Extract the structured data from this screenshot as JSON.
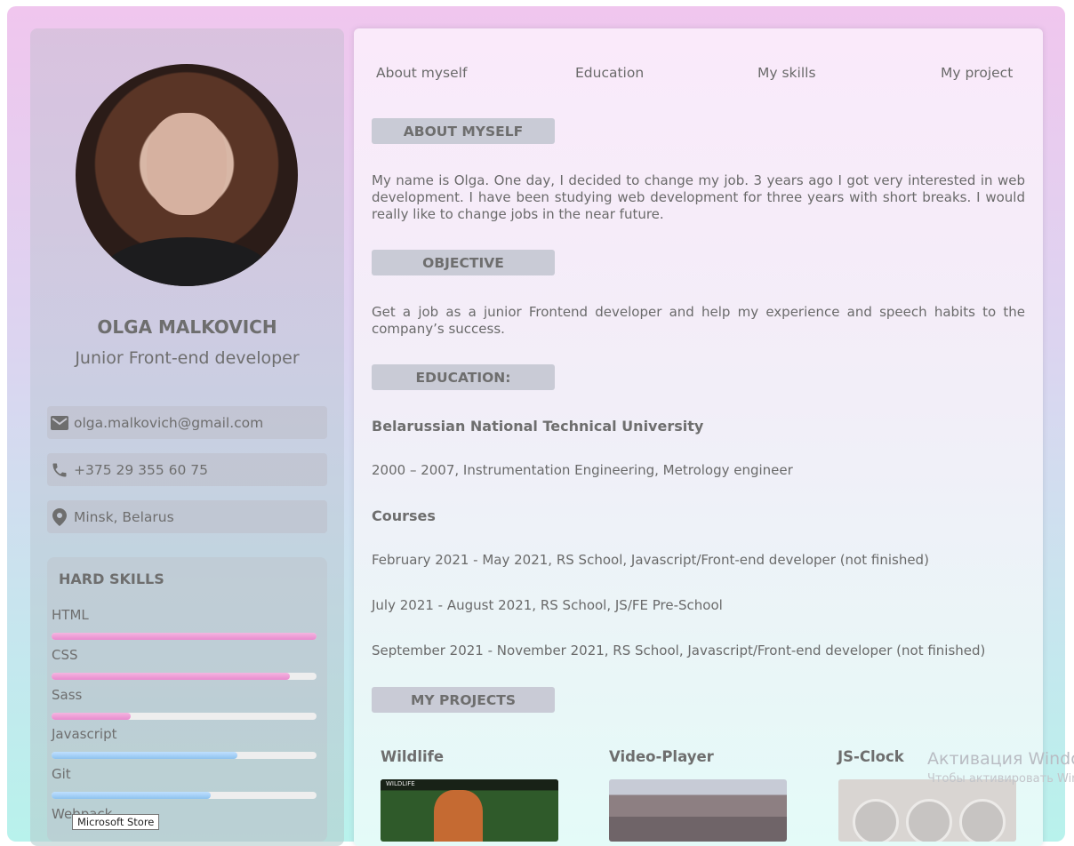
{
  "sidebar": {
    "name": "OLGA MALKOVICH",
    "role": "Junior Front-end developer",
    "contacts": [
      {
        "icon": "mail-icon",
        "text": "olga.malkovich@gmail.com"
      },
      {
        "icon": "phone-icon",
        "text": "+375 29 355 60 75"
      },
      {
        "icon": "location-pin-icon",
        "text": "Minsk, Belarus"
      }
    ],
    "hard_skills": {
      "title": "HARD SKILLS",
      "items": [
        {
          "label": "HTML",
          "level": 1.0,
          "color": "pink"
        },
        {
          "label": "CSS",
          "level": 0.9,
          "color": "pink"
        },
        {
          "label": "Sass",
          "level": 0.3,
          "color": "pink"
        },
        {
          "label": "Javascript",
          "level": 0.7,
          "color": "blue"
        },
        {
          "label": "Git",
          "level": 0.6,
          "color": "blue"
        },
        {
          "label": "Webpack",
          "level": 0.0,
          "color": "blue"
        }
      ]
    }
  },
  "nav": [
    "About myself",
    "Education",
    "My skills",
    "My project"
  ],
  "sections": {
    "about_heading": "ABOUT MYSELF",
    "about_text": "My name is Olga. One day, I decided to change my job. 3 years ago I got very interested in web development. I have been studying web development for three years with short breaks. I would really like to change jobs in the near future.",
    "objective_heading": "OBJECTIVE",
    "objective_text": "Get a job as a junior Frontend developer and help my experience and speech habits to the company’s success.",
    "education_heading": "EDUCATION:",
    "university": "Belarussian National Technical University",
    "university_detail": "2000 – 2007, Instrumentation Engineering, Metrology engineer",
    "courses_title": "Courses",
    "courses": [
      "February 2021 - May 2021, RS School, Javascript/Front-end developer (not finished)",
      "July 2021 - August 2021, RS School, JS/FE Pre-School",
      "September 2021 - November 2021, RS School, Javascript/Front-end developer (not finished)"
    ],
    "projects_heading": "MY PROJECTS",
    "projects": [
      {
        "title": "Wildlife",
        "thumb_text": "WILDLIFE"
      },
      {
        "title": "Video-Player"
      },
      {
        "title": "JS-Clock"
      }
    ]
  },
  "watermark": {
    "line1": "Активация Windows",
    "line2": "Чтобы активировать Windows"
  },
  "tooltip": "Microsoft Store",
  "colors": {
    "skill_pink": "#e98bcf",
    "skill_blue": "#8ec2ee",
    "heading_bg": "#c9cbd6"
  }
}
